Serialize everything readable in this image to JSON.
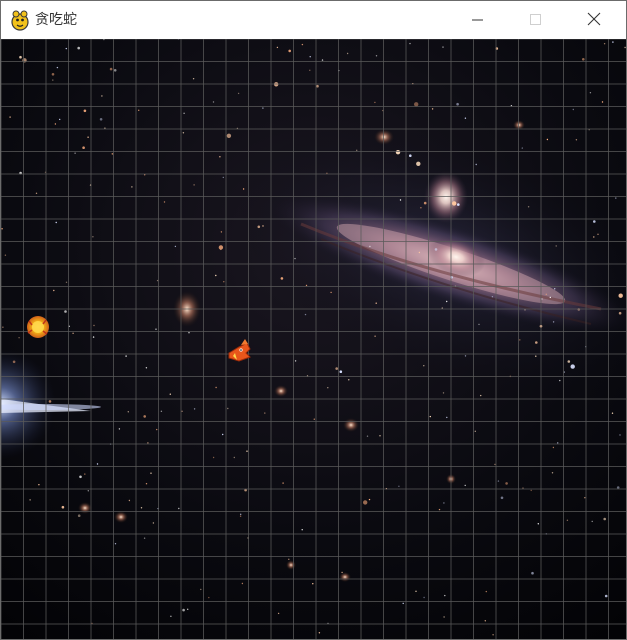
{
  "window": {
    "title": "贪吃蛇",
    "app_icon": "python-snake-icon",
    "controls": [
      "minimize-icon",
      "maximize-icon",
      "close-icon"
    ]
  },
  "game": {
    "background": "galaxy-starfield",
    "grid": true,
    "grid_color": "#5a5a5a",
    "snake": {
      "length": 1,
      "direction": "right",
      "color": "#e8561b"
    },
    "food": {
      "color": "#f5b316"
    }
  },
  "colors": {
    "titlebar_bg": "#ffffff",
    "title_text": "#333333",
    "space_bg": "#05050a"
  }
}
